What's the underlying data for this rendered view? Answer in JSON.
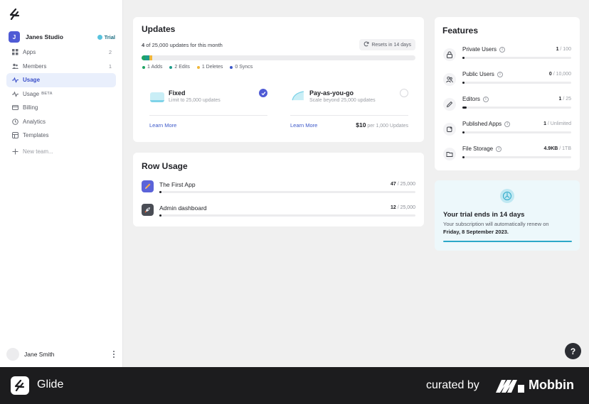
{
  "team": {
    "initial": "J",
    "name": "Janes Studio",
    "badge": "Trial"
  },
  "nav": [
    {
      "label": "Apps",
      "count": "2",
      "icon": "grid-icon"
    },
    {
      "label": "Members",
      "count": "1",
      "icon": "users-icon"
    },
    {
      "label": "Usage",
      "count": "",
      "icon": "activity-icon",
      "active": true
    },
    {
      "label": "Usage",
      "beta": "BETA",
      "icon": "activity-icon"
    },
    {
      "label": "Billing",
      "icon": "billing-icon"
    },
    {
      "label": "Analytics",
      "icon": "clock-icon"
    },
    {
      "label": "Templates",
      "icon": "template-icon"
    },
    {
      "label": "New team...",
      "icon": "plus-icon"
    }
  ],
  "user": {
    "name": "Jane Smith"
  },
  "updates": {
    "title": "Updates",
    "used": "4",
    "subtitle": "of 25,000 updates for this month",
    "resets": "Resets in 14 days",
    "legend": [
      {
        "label": "1 Adds",
        "color": "#1fa463"
      },
      {
        "label": "2 Edits",
        "color": "#1f9b8a"
      },
      {
        "label": "1 Deletes",
        "color": "#f0b73a"
      },
      {
        "label": "0 Syncs",
        "color": "#3b57c9"
      }
    ],
    "plans": {
      "fixed": {
        "name": "Fixed",
        "desc": "Limit to 25,000 updates",
        "learn": "Learn More"
      },
      "payg": {
        "name": "Pay-as-you-go",
        "desc": "Scale beyond 25,000 updates",
        "learn": "Learn More",
        "price": "$10",
        "price_unit": "per 1,000 Updates"
      }
    }
  },
  "row_usage": {
    "title": "Row Usage",
    "items": [
      {
        "name": "The First App",
        "used": "47",
        "total": "/ 25,000",
        "fraction": 0.002
      },
      {
        "name": "Admin dashboard",
        "used": "12",
        "total": "/ 25,000",
        "fraction": 0.001
      }
    ]
  },
  "features": {
    "title": "Features",
    "items": [
      {
        "name": "Private Users",
        "used": "1",
        "total": "/ 100",
        "icon": "lock-icon",
        "fraction": 0.01
      },
      {
        "name": "Public Users",
        "used": "0",
        "total": "/ 10,000",
        "icon": "users-icon",
        "fraction": 0.0
      },
      {
        "name": "Editors",
        "used": "1",
        "total": "/ 25",
        "icon": "pencil-icon",
        "fraction": 0.04
      },
      {
        "name": "Published Apps",
        "used": "1",
        "total": "/ Unlimited",
        "icon": "publish-icon",
        "fraction": 0.01
      },
      {
        "name": "File Storage",
        "used": "4.9KB",
        "total": "/ 1TB",
        "icon": "folder-icon",
        "fraction": 0.01
      }
    ]
  },
  "trial": {
    "title": "Your trial ends in 14 days",
    "desc": "Your subscription will automatically renew on",
    "date": "Friday, 8 September 2023."
  },
  "help": "?",
  "footer": {
    "app": "Glide",
    "curated": "curated by",
    "brand": "Mobbin"
  }
}
